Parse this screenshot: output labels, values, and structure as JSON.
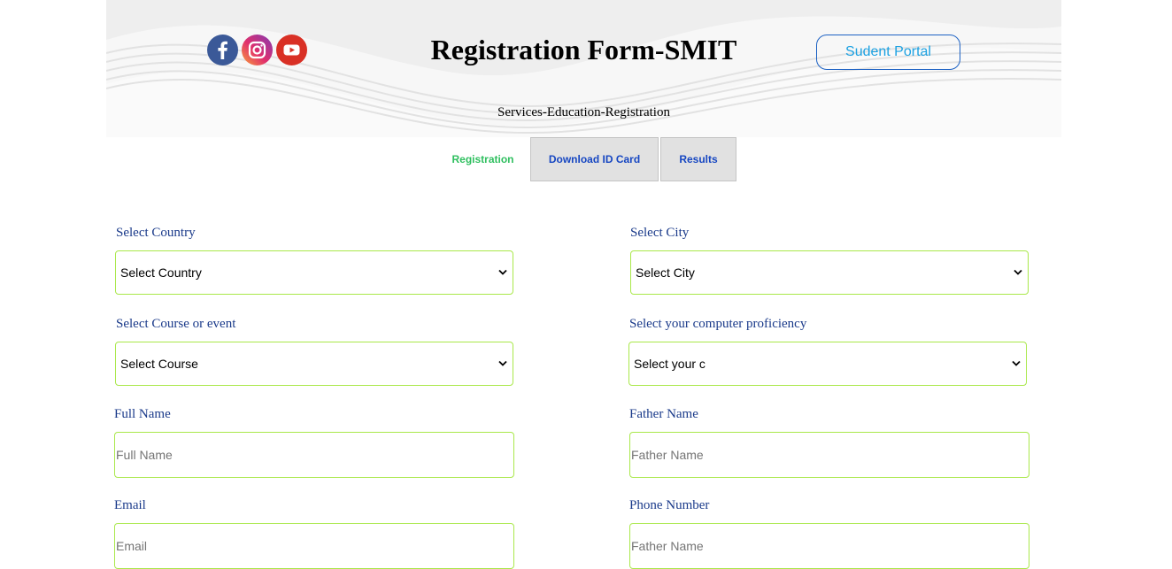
{
  "header": {
    "title": "Registration Form-SMIT",
    "subtitle": "Services-Education-Registration",
    "portal_button": "Sudent Portal",
    "socials": [
      "facebook-icon",
      "instagram-icon",
      "youtube-icon"
    ]
  },
  "tabs": [
    {
      "label": "Registration",
      "active": true
    },
    {
      "label": "Download ID Card",
      "active": false
    },
    {
      "label": "Results",
      "active": false
    }
  ],
  "form": {
    "country": {
      "label": "Select Country",
      "value": "Select Country"
    },
    "city": {
      "label": "Select City",
      "value": "Select City"
    },
    "course": {
      "label": "Select Course or event",
      "value": "Select Course"
    },
    "proficiency": {
      "label": "Select your computer proficiency",
      "value": "Select your c"
    },
    "full_name": {
      "label": "Full Name",
      "placeholder": "Full Name"
    },
    "father_name": {
      "label": "Father Name",
      "placeholder": "Father Name"
    },
    "email": {
      "label": "Email",
      "placeholder": "Email"
    },
    "phone": {
      "label": "Phone Number",
      "placeholder": "Father Name"
    }
  },
  "colors": {
    "active_tab": "#2fbf5f",
    "tab_text": "#1747c2",
    "field_border": "#a9e84a",
    "label": "#1a3a8a",
    "portal_text": "#1ba1e2"
  }
}
